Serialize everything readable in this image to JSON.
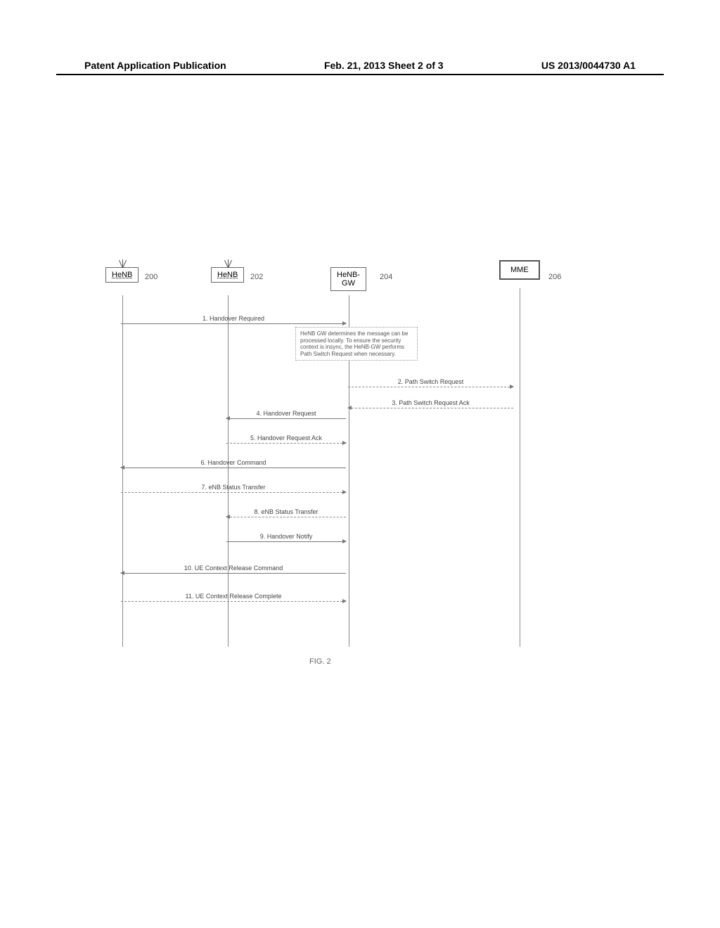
{
  "header": {
    "left": "Patent Application Publication",
    "mid": "Feb. 21, 2013  Sheet 2 of 3",
    "right": "US 2013/0044730 A1"
  },
  "nodes": {
    "henb1": {
      "label": "HeNB",
      "ref": "200"
    },
    "henb2": {
      "label": "HeNB",
      "ref": "202"
    },
    "gw": {
      "label": "HeNB-\nGW",
      "ref": "204"
    },
    "mme": {
      "label": "MME",
      "ref": "206"
    }
  },
  "note": "HeNB GW determines the message can be processed locally. To ensure the security context is insync, the HeNB-GW performs Path Switch Request when necessary.",
  "messages": {
    "m1": "1.  Handover Required",
    "m2": "2. Path Switch Request",
    "m3": "3. Path Switch Request Ack",
    "m4": "4. Handover Request",
    "m5": "5. Handover Request Ack",
    "m6": "6. Handover Command",
    "m7": "7. eNB Status Transfer",
    "m8": "8. eNB Status Transfer",
    "m9": "9. Handover Notify",
    "m10": "10. UE Context Release Command",
    "m11": "11. UE Context Release Complete"
  },
  "figure_label": "FIG. 2"
}
